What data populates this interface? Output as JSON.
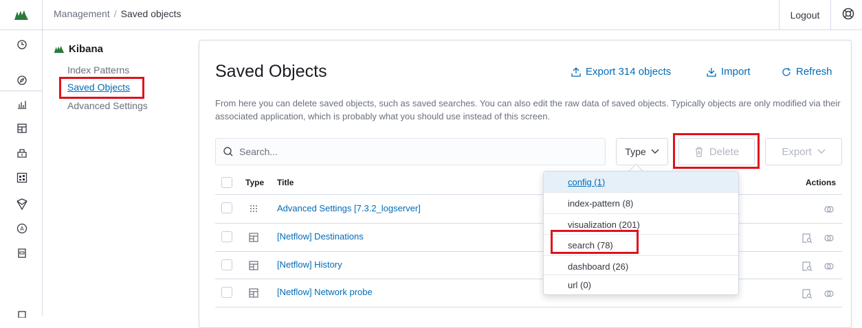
{
  "topbar": {
    "breadcrumb_parent": "Management",
    "breadcrumb_sep": "/",
    "breadcrumb_current": "Saved objects",
    "logout": "Logout",
    "logo_icon": "kibana-logo-icon",
    "help_icon": "help-icon"
  },
  "leftnav": {
    "icons": [
      "clock-icon",
      "compass-icon",
      "visualize-icon",
      "dashboard-icon",
      "canvas-icon",
      "maps-icon",
      "ml-icon",
      "infra-icon",
      "apm-icon",
      "logs-icon"
    ]
  },
  "sidebar": {
    "title": "Kibana",
    "items": [
      {
        "label": "Index Patterns"
      },
      {
        "label": "Saved Objects"
      },
      {
        "label": "Advanced Settings"
      }
    ]
  },
  "main": {
    "title": "Saved Objects",
    "export_label": "Export 314 objects",
    "import_label": "Import",
    "refresh_label": "Refresh",
    "description": "From here you can delete saved objects, such as saved searches. You can also edit the raw data of saved objects. Typically objects are only modified via their associated application, which is probably what you should use instead of this screen.",
    "search_placeholder": "Search...",
    "type_label": "Type",
    "delete_label": "Delete",
    "export_btn_label": "Export"
  },
  "table": {
    "headers": {
      "type": "Type",
      "title": "Title",
      "actions": "Actions"
    },
    "rows": [
      {
        "type_icon": "settings-grid-icon",
        "title": "Advanced Settings [7.3.2_logserver]"
      },
      {
        "type_icon": "search-object-icon",
        "title": "[Netflow] Destinations"
      },
      {
        "type_icon": "search-object-icon",
        "title": "[Netflow] History"
      },
      {
        "type_icon": "search-object-icon",
        "title": "[Netflow] Network probe"
      }
    ]
  },
  "type_filter": {
    "options": [
      {
        "label": "config (1)"
      },
      {
        "label": "index-pattern (8)"
      },
      {
        "label": "visualization (201)"
      },
      {
        "label": "search (78)"
      },
      {
        "label": "dashboard (26)"
      },
      {
        "label": "url (0)"
      }
    ]
  },
  "colors": {
    "accent": "#006bb8",
    "highlight_box": "#e0111b",
    "brand": "#2a7a3b"
  }
}
